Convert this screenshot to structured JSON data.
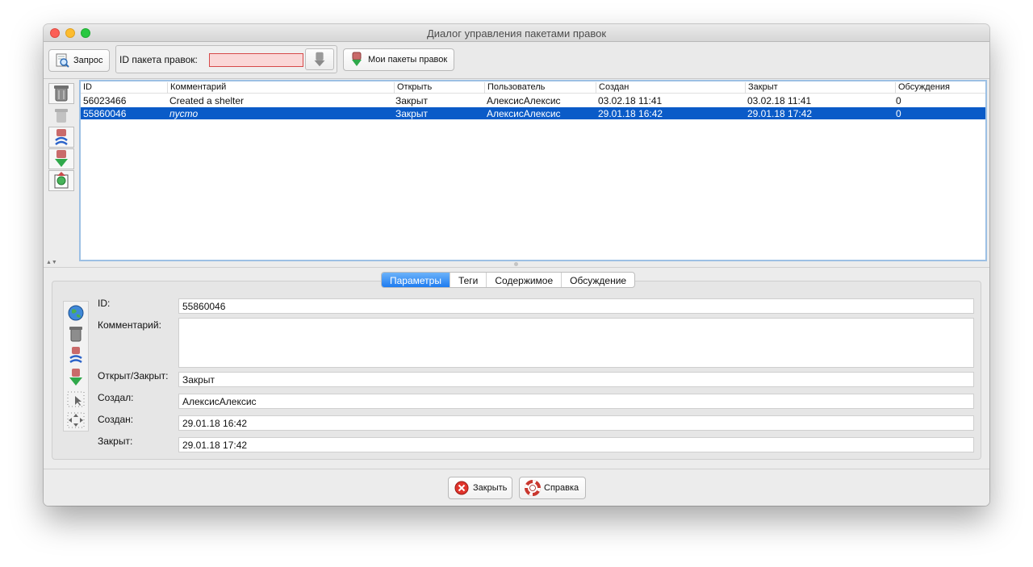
{
  "window": {
    "title": "Диалог управления пакетами правок"
  },
  "toolbar": {
    "query_label": "Запрос",
    "id_label": "ID пакета правок:",
    "id_value": "",
    "my_changesets_label": "Мои пакеты правок"
  },
  "table": {
    "columns": [
      "ID",
      "Комментарий",
      "Открыть",
      "Пользователь",
      "Создан",
      "Закрыт",
      "Обсуждения"
    ],
    "rows": [
      [
        "56023466",
        "Created a shelter",
        "Закрыт",
        "АлексисАлексис",
        "03.02.18 11:41",
        "03.02.18 11:41",
        "0"
      ],
      [
        "55860046",
        "пусто",
        "Закрыт",
        "АлексисАлексис",
        "29.01.18 16:42",
        "29.01.18 17:42",
        "0"
      ]
    ],
    "selected_row": 1
  },
  "tabs": [
    "Параметры",
    "Теги",
    "Содержимое",
    "Обсуждение"
  ],
  "details": {
    "id_label": "ID:",
    "id_value": "55860046",
    "comment_label": "Комментарий:",
    "comment_value": "",
    "open_closed_label": "Открыт/Закрыт:",
    "open_closed_value": "Закрыт",
    "created_by_label": "Создал:",
    "created_by_value": "АлексисАлексис",
    "created_label": "Создан:",
    "created_value": "29.01.18 16:42",
    "closed_label": "Закрыт:",
    "closed_value": "29.01.18 17:42"
  },
  "footer": {
    "close_label": "Закрыть",
    "help_label": "Справка"
  },
  "colors": {
    "selection": "#0a5bc8",
    "active_tab": "#1e7bf0",
    "invalid_field": "#fad7d7"
  }
}
